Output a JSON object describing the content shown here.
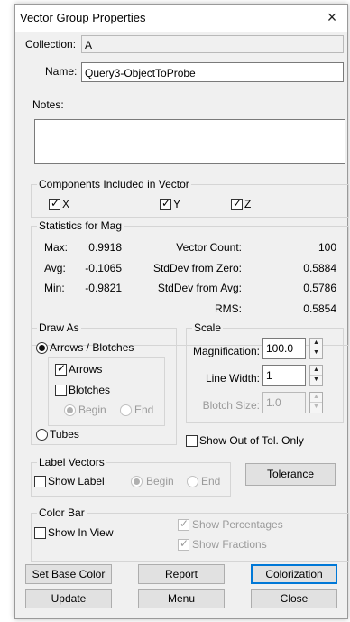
{
  "window": {
    "title": "Vector Group Properties",
    "close_glyph": "×"
  },
  "fields": {
    "collection_label": "Collection:",
    "collection_value": "A",
    "name_label": "Name:",
    "name_value": "Query3-ObjectToProbe",
    "notes_label": "Notes:",
    "notes_value": ""
  },
  "components": {
    "title": "Components Included in Vector",
    "x": "X",
    "y": "Y",
    "z": "Z"
  },
  "stats": {
    "title": "Statistics for Mag",
    "max_label": "Max:",
    "max_value": "0.9918",
    "avg_label": "Avg:",
    "avg_value": "-0.1065",
    "min_label": "Min:",
    "min_value": "-0.9821",
    "vector_count_label": "Vector Count:",
    "vector_count_value": "100",
    "stddev_zero_label": "StdDev from Zero:",
    "stddev_zero_value": "0.5884",
    "stddev_avg_label": "StdDev from  Avg:",
    "stddev_avg_value": "0.5786",
    "rms_label": "RMS:",
    "rms_value": "0.5854"
  },
  "draw_as": {
    "title": "Draw As",
    "arrows_blotches": "Arrows / Blotches",
    "arrows": "Arrows",
    "blotches": "Blotches",
    "begin": "Begin",
    "end": "End",
    "tubes": "Tubes"
  },
  "scale": {
    "title": "Scale",
    "magnification_label": "Magnification:",
    "magnification_value": "100.0",
    "line_width_label": "Line Width:",
    "line_width_value": "1",
    "blotch_size_label": "Blotch Size:",
    "blotch_size_value": "1.0"
  },
  "show_out_of_tol": "Show Out of Tol. Only",
  "label_vectors": {
    "title": "Label Vectors",
    "show_label": "Show Label",
    "begin": "Begin",
    "end": "End"
  },
  "tolerance_button": "Tolerance",
  "color_bar": {
    "title": "Color Bar",
    "show_in_view": "Show In View",
    "show_percentages": "Show Percentages",
    "show_fractions": "Show Fractions"
  },
  "buttons": {
    "set_base_color": "Set Base Color",
    "report": "Report",
    "colorization": "Colorization",
    "update": "Update",
    "menu": "Menu",
    "close": "Close"
  },
  "spin": {
    "up": "▲",
    "down": "▼"
  },
  "check_glyph": "✓"
}
